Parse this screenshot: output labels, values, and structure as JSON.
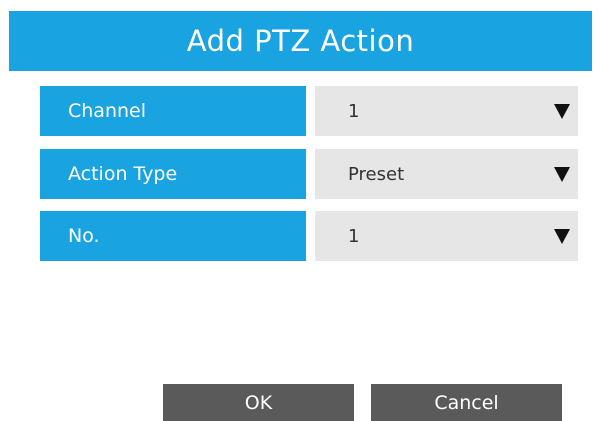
{
  "dialog": {
    "title": "Add PTZ Action",
    "accent_color": "#1aa3e1",
    "field_bg_color": "#e6e6e6",
    "button_color": "#5a5a5a"
  },
  "fields": {
    "channel": {
      "label": "Channel",
      "value": "1",
      "icon": "chevron-down-icon"
    },
    "action_type": {
      "label": "Action Type",
      "value": "Preset",
      "icon": "chevron-down-icon"
    },
    "number": {
      "label": "No.",
      "value": "1",
      "icon": "chevron-down-icon"
    }
  },
  "buttons": {
    "ok_label": "OK",
    "cancel_label": "Cancel"
  }
}
